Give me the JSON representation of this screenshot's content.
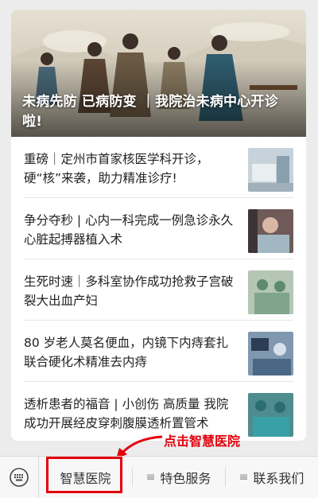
{
  "banner": {
    "title": "未病先防 已病防变 ｜我院治未病中心开诊啦!"
  },
  "news": [
    {
      "title": "重磅｜定州市首家核医学科开诊，硬“核”来袭，助力精准诊疗!",
      "thumb": "hospital-room-thumbnail"
    },
    {
      "title": "争分夺秒 | 心内一科完成一例急诊永久心脏起搏器植入术",
      "thumb": "patient-thumbnail"
    },
    {
      "title": "生死时速｜多科室协作成功抢救子宫破裂大出血产妇",
      "thumb": "surgery-team-thumbnail"
    },
    {
      "title": "80 岁老人莫名便血，内镜下内痔套扎联合硬化术精准去内痔",
      "thumb": "endoscopy-thumbnail"
    },
    {
      "title": "透析患者的福音 | 小创伤 高质量 我院成功开展经皮穿刺腹膜透析置管术",
      "thumb": "operating-room-thumbnail"
    }
  ],
  "annotation": {
    "label": "点击智慧医院",
    "color": "#e3000b"
  },
  "menu": {
    "keyboard_icon": "keyboard-icon",
    "items": [
      {
        "label": "智慧医院",
        "prefix": ""
      },
      {
        "label": "特色服务",
        "prefix": "≡"
      },
      {
        "label": "联系我们",
        "prefix": "≡"
      }
    ]
  }
}
